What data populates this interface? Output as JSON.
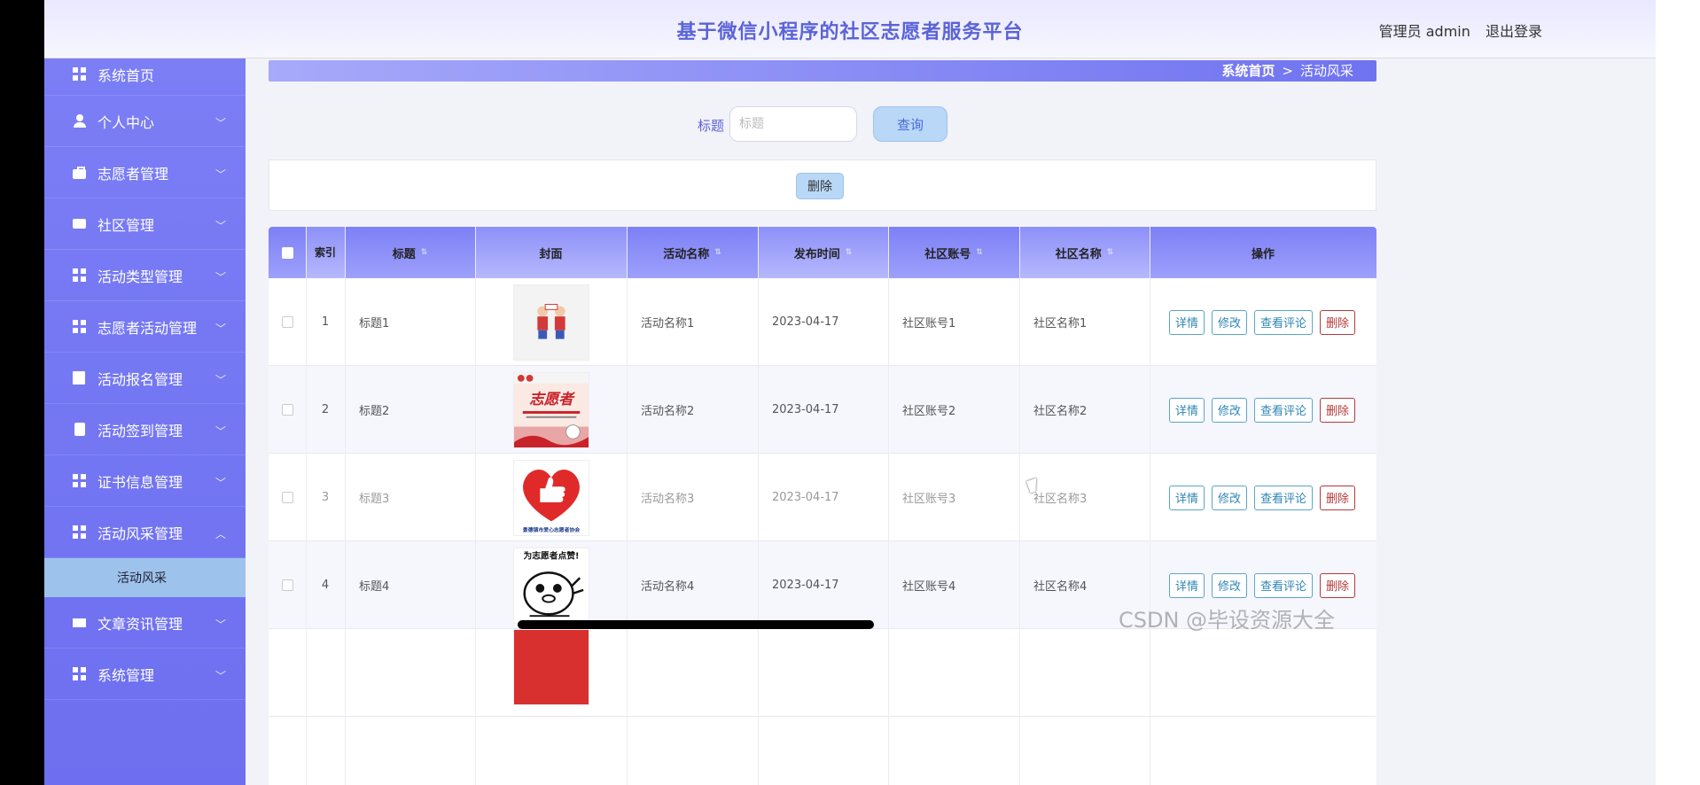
{
  "header": {
    "title": "基于微信小程序的社区志愿者服务平台",
    "user": "管理员 admin",
    "logout": "退出登录"
  },
  "sidebar": {
    "items": [
      {
        "label": "系统首页",
        "icon": "grid-icon"
      },
      {
        "label": "个人中心",
        "icon": "user-icon"
      },
      {
        "label": "志愿者管理",
        "icon": "briefcase-icon"
      },
      {
        "label": "社区管理",
        "icon": "chat-icon"
      },
      {
        "label": "活动类型管理",
        "icon": "grid-icon"
      },
      {
        "label": "志愿者活动管理",
        "icon": "grid-icon"
      },
      {
        "label": "活动报名管理",
        "icon": "book-icon"
      },
      {
        "label": "活动签到管理",
        "icon": "clipboard-icon"
      },
      {
        "label": "证书信息管理",
        "icon": "grid-icon"
      },
      {
        "label": "活动风采管理",
        "icon": "grid-icon"
      },
      {
        "label": "文章资讯管理",
        "icon": "card-icon"
      },
      {
        "label": "系统管理",
        "icon": "grid-icon"
      }
    ],
    "sub_item": "活动风采",
    "chevron_down": "﹀",
    "chevron_up": "︿"
  },
  "breadcrumb": {
    "home": "系统首页",
    "separator": ">",
    "current": "活动风采"
  },
  "search": {
    "label": "标题",
    "placeholder": "标题",
    "button": "查询"
  },
  "actions": {
    "delete": "删除"
  },
  "table": {
    "columns": {
      "index": "索引",
      "title": "标题",
      "cover": "封面",
      "activity_name": "活动名称",
      "publish_time": "发布时间",
      "community_account": "社区账号",
      "community_name": "社区名称",
      "operation": "操作"
    },
    "rows": [
      {
        "index": "1",
        "title": "标题1",
        "activity_name": "活动名称1",
        "publish_time": "2023-04-17",
        "community_account": "社区账号1",
        "community_name": "社区名称1"
      },
      {
        "index": "2",
        "title": "标题2",
        "activity_name": "活动名称2",
        "publish_time": "2023-04-17",
        "community_account": "社区账号2",
        "community_name": "社区名称2"
      },
      {
        "index": "3",
        "title": "标题3",
        "activity_name": "活动名称3",
        "publish_time": "2023-04-17",
        "community_account": "社区账号3",
        "community_name": "社区名称3"
      },
      {
        "index": "4",
        "title": "标题4",
        "activity_name": "活动名称4",
        "publish_time": "2023-04-17",
        "community_account": "社区账号4",
        "community_name": "社区名称4"
      }
    ],
    "row_buttons": {
      "detail": "详情",
      "edit": "修改",
      "comments": "查看评论",
      "delete": "删除"
    },
    "cover_texts": {
      "poster2": "志愿者",
      "logo3": "景德镇市爱心志愿者协会",
      "sticker4": "为志愿者点赞!"
    }
  },
  "watermark": "CSDN @毕设资源大全",
  "colors": {
    "accent": "#6f73f0",
    "title": "#5a63d8",
    "button_bg": "#b9d8f7",
    "danger": "#b53a3a"
  }
}
